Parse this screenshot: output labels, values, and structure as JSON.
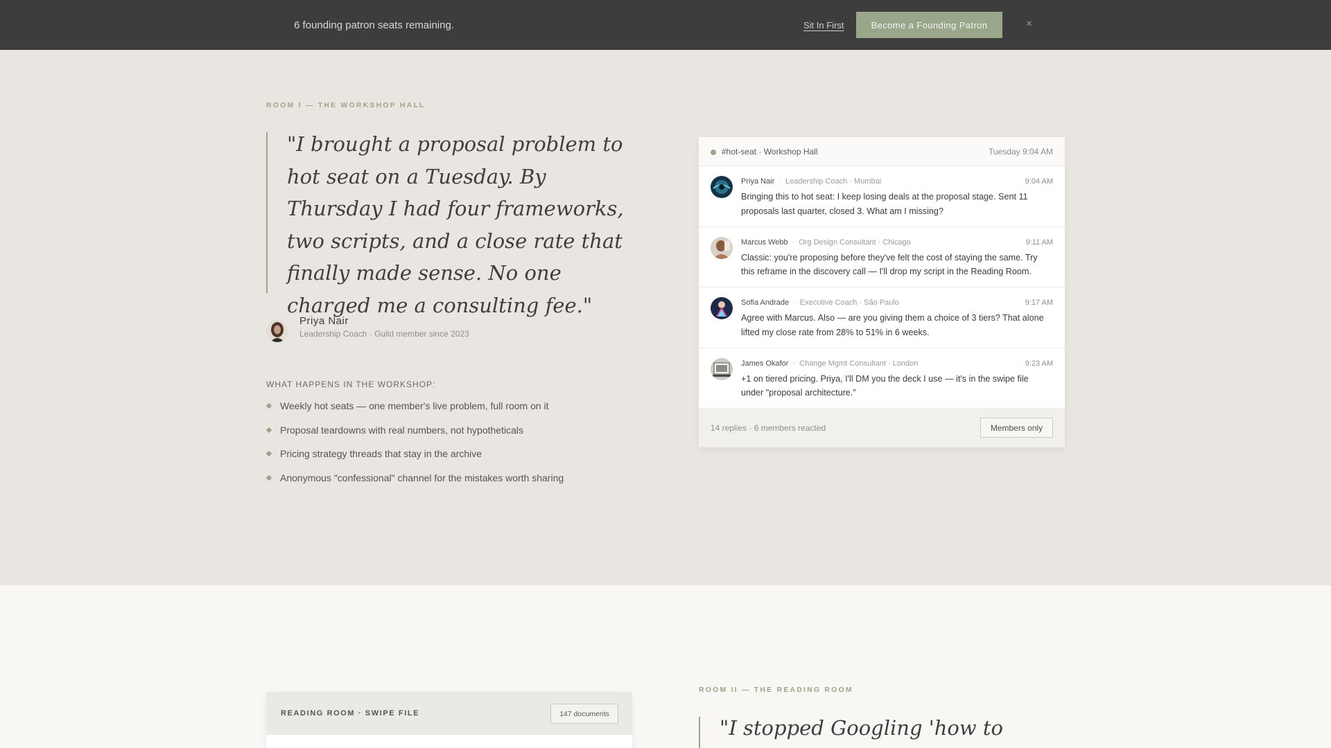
{
  "banner": {
    "message": "6 founding patron seats remaining.",
    "link_label": "Sit In First",
    "cta_label": "Become a Founding Patron",
    "close_label": "×"
  },
  "workshop": {
    "eyebrow": "ROOM I — THE WORKSHOP HALL",
    "quote": "\"I brought a proposal problem to hot seat on a Tuesday. By Thursday I had four frameworks, two scripts, and a close rate that finally made sense. No one charged me a consulting fee.\"",
    "author": {
      "name": "Priya Nair",
      "meta": "Leadership Coach · Guild member since 2023"
    },
    "list_heading": "WHAT HAPPENS IN THE WORKSHOP:",
    "features": [
      "Weekly hot seats — one member's live problem, full room on it",
      "Proposal teardowns with real numbers, not hypotheticals",
      "Pricing strategy threads that stay in the archive",
      "Anonymous \"confessional\" channel for the mistakes worth sharing"
    ]
  },
  "chat": {
    "channel": "#hot-seat · Workshop Hall",
    "when": "Tuesday 9:04 AM",
    "messages": [
      {
        "name": "Priya Nair",
        "role": "Leadership Coach · Mumbai",
        "time": "9:04 AM",
        "text": "Bringing this to hot seat: I keep losing deals at the proposal stage. Sent 11 proposals last quarter, closed 3. What am I missing?"
      },
      {
        "name": "Marcus Webb",
        "role": "Org Design Consultant · Chicago",
        "time": "9:11 AM",
        "text": "Classic: you're proposing before they've felt the cost of staying the same. Try this reframe in the discovery call — I'll drop my script in the Reading Room."
      },
      {
        "name": "Sofia Andrade",
        "role": "Executive Coach · São Paulo",
        "time": "9:17 AM",
        "text": "Agree with Marcus. Also — are you giving them a choice of 3 tiers? That alone lifted my close rate from 28% to 51% in 6 weeks."
      },
      {
        "name": "James Okafor",
        "role": "Change Mgmt Consultant · London",
        "time": "9:23 AM",
        "text": "+1 on tiered pricing. Priya, I'll DM you the deck I use — it's in the swipe file under \"proposal architecture.\""
      }
    ],
    "footer_stats": "14 replies · 6 members reacted",
    "members_label": "Members only",
    "sep": "·"
  },
  "reading": {
    "card_title": "READING ROOM · SWIPE FILE",
    "doc_count": "147 documents",
    "eyebrow": "ROOM II — THE READING ROOM",
    "quote": "\"I stopped Googling 'how to handle"
  },
  "colors": {
    "accent": "#9aa68a",
    "banner_bg": "#3c3d3c",
    "page_bg": "#e9e6e1",
    "section2_bg": "#f8f7f4"
  }
}
